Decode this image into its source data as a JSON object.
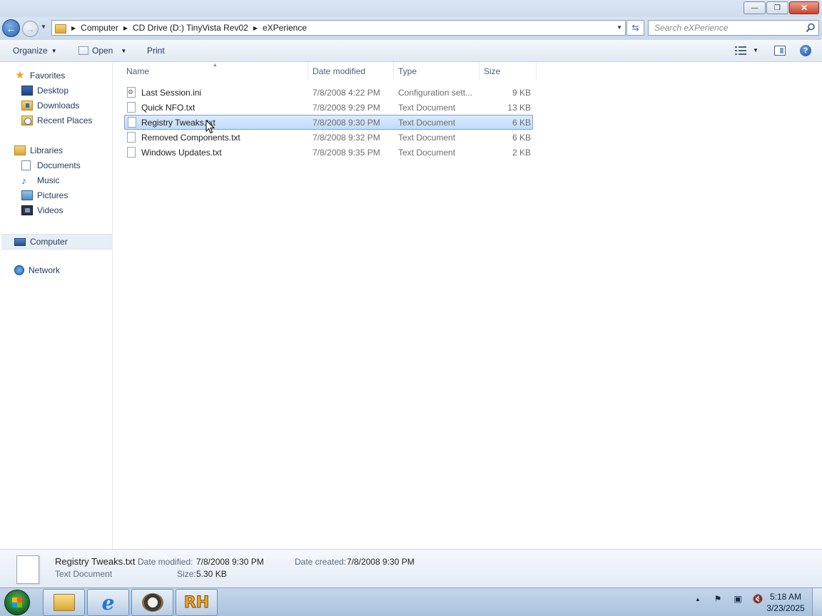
{
  "window": {
    "minimize_label": "—",
    "maximize_label": "❐",
    "close_label": "✕"
  },
  "address": {
    "crumbs": [
      "Computer",
      "CD Drive (D:) TinyVista Rev02",
      "eXPerience"
    ],
    "search_placeholder": "Search eXPerience"
  },
  "toolbar": {
    "organize": "Organize",
    "open": "Open",
    "print": "Print"
  },
  "nav": {
    "favorites": "Favorites",
    "desktop": "Desktop",
    "downloads": "Downloads",
    "recent_places": "Recent Places",
    "libraries": "Libraries",
    "documents": "Documents",
    "music": "Music",
    "pictures": "Pictures",
    "videos": "Videos",
    "computer": "Computer",
    "network": "Network"
  },
  "columns": {
    "name": "Name",
    "date_modified": "Date modified",
    "type": "Type",
    "size": "Size"
  },
  "files": [
    {
      "name": "Last Session.ini",
      "date": "7/8/2008 4:22 PM",
      "type": "Configuration sett...",
      "size": "9 KB",
      "selected": false,
      "kind": "ini"
    },
    {
      "name": "Quick NFO.txt",
      "date": "7/8/2008 9:29 PM",
      "type": "Text Document",
      "size": "13 KB",
      "selected": false,
      "kind": "txt"
    },
    {
      "name": "Registry Tweaks.txt",
      "date": "7/8/2008 9:30 PM",
      "type": "Text Document",
      "size": "6 KB",
      "selected": true,
      "kind": "txt"
    },
    {
      "name": "Removed Components.txt",
      "date": "7/8/2008 9:32 PM",
      "type": "Text Document",
      "size": "6 KB",
      "selected": false,
      "kind": "txt"
    },
    {
      "name": "Windows Updates.txt",
      "date": "7/8/2008 9:35 PM",
      "type": "Text Document",
      "size": "2 KB",
      "selected": false,
      "kind": "txt"
    }
  ],
  "details": {
    "filename": "Registry Tweaks.txt",
    "filetype": "Text Document",
    "date_modified_label": "Date modified:",
    "date_modified": "7/8/2008 9:30 PM",
    "size_label": "Size:",
    "size": "5.30 KB",
    "date_created_label": "Date created:",
    "date_created": "7/8/2008 9:30 PM"
  },
  "taskbar": {
    "ie_glyph": "e",
    "rh_label": "RH",
    "time": "5:18 AM",
    "date": "3/23/2025"
  }
}
